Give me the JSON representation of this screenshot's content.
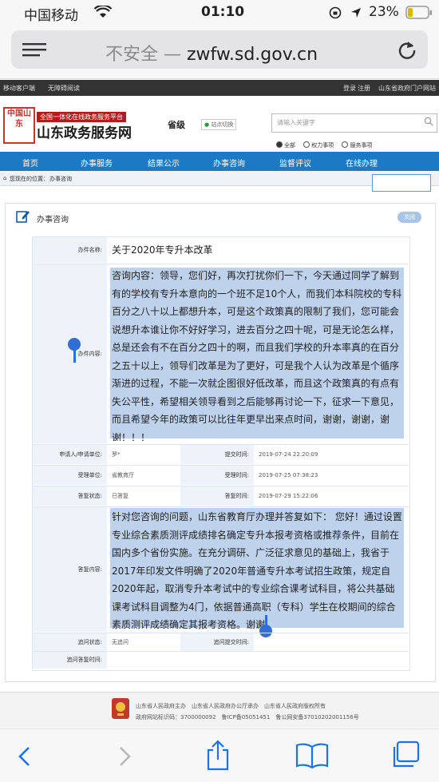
{
  "status": {
    "carrier": "中国移动",
    "time": "01:10",
    "battery": "23%"
  },
  "browser": {
    "insecure": "不安全 —",
    "domain": "zwfw.sd.gov.cn"
  },
  "topstrip": {
    "mobile": "移动客户端",
    "accessible": "无障碍阅读",
    "login": "登录",
    "register": "注册",
    "portal": "山东省政府门户网站"
  },
  "header": {
    "logo_seal": "中国山东",
    "logo_sub": "全国一体化在线政务服务平台",
    "logo_main": "山东政务服务网",
    "level": "省级",
    "switch": "站点切换",
    "search_placeholder": "请输入关键字"
  },
  "radios": [
    {
      "label": "全部",
      "checked": true
    },
    {
      "label": "权力事项",
      "checked": false
    },
    {
      "label": "服务事项",
      "checked": false
    }
  ],
  "nav": [
    "首页",
    "办事服务",
    "结果公示",
    "办事咨询",
    "监督评议",
    "在线办理"
  ],
  "breadcrumb": {
    "prefix": "您现在的位置：",
    "current": "办事咨询"
  },
  "panel": {
    "title": "办事咨询",
    "close": "关闭"
  },
  "form": {
    "name_label": "办件名称:",
    "name_value": "关于2020年专升本改革",
    "content_label": "办件内容:",
    "content_value": "咨询内容：领导，您们好，再次打扰你们一下，今天通过同学了解到有的学校有专升本意向的一个班不足10个人，而我们本科院校的专科百分之八十以上都想升本，可是这个政策真的限制了我们，您可能会说想升本谁让你不好好学习，进去百分之四十呢，可是无论怎么样，总是还会有不在百分之四十的啊，而且我们学校的升本率真的在百分之五十以上，领导们改革是为了更好，可是我个人认为改革是个循序渐进的过程，不能一次就企图很好低改革，而且这个政策真的有点有失公平性，希望相关领导看到之后能够再讨论一下，征求一下意见，而且希望今年的政策可以比往年更早出来点时间，谢谢，谢谢，谢谢！！！",
    "applicant_label": "申请人/申请单位:",
    "applicant_value": "罗*",
    "submit_time_label": "提交时间:",
    "submit_time_value": "2019-07-24 22:20:09",
    "unit_label": "受理单位:",
    "unit_value": "省教育厅",
    "accept_time_label": "受理时间:",
    "accept_time_value": "2019-07-25 07:38:23",
    "reply_status_label": "答复状态:",
    "reply_status_value": "已答复",
    "reply_time_label": "答复时间:",
    "reply_time_value": "2019-07-29 15:22:06",
    "reply_content_label": "答复内容:",
    "reply_content_value": "针对您咨询的问题，山东省教育厅办理并答复如下： 您好！通过设置专业综合素质测评成绩排名确定专升本报考资格或推荐条件，目前在国内多个省份实施。在充分调研、广泛征求意见的基础上，我省于2017年印发文件明确了2020年普通专升本考试招生政策，规定自2020年起，取消专升本考试中的专业综合课考试科目，将公共基础课考试科目调整为4门，依据普通高职（专科）学生在校期间的综合素质测评成绩确定其报考资格。谢谢。",
    "followup_status_label": "追问状态:",
    "followup_status_value": "无追问",
    "followup_submit_label": "追问提交时间:",
    "followup_reply_label": "追问答复时间:"
  },
  "footer": {
    "line1": "山东省人民政府主办　山东省人民政府办公厅承办　山东省人民政府版权所有",
    "line2": "政府网站标识码：3700000092　鲁ICP备05051451　鲁公网安备37010202001156号"
  },
  "colors": {
    "nav": "#1c79c3",
    "highlight": "#bfd2ec",
    "handle": "#2f6fd6",
    "brand_red": "#b31c1c"
  }
}
